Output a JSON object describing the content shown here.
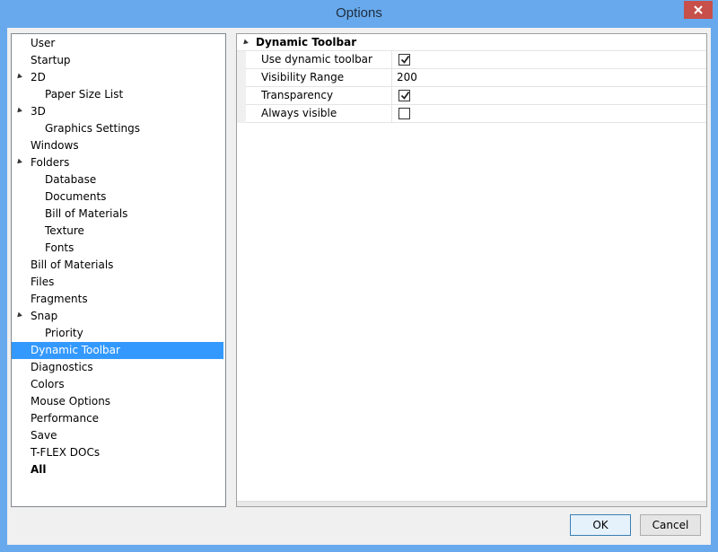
{
  "window": {
    "title": "Options"
  },
  "tree": {
    "items": [
      {
        "label": "User",
        "level": 0
      },
      {
        "label": "Startup",
        "level": 0
      },
      {
        "label": "2D",
        "level": 0,
        "expanded": true
      },
      {
        "label": "Paper Size List",
        "level": 1
      },
      {
        "label": "3D",
        "level": 0,
        "expanded": true
      },
      {
        "label": "Graphics Settings",
        "level": 1
      },
      {
        "label": "Windows",
        "level": 0
      },
      {
        "label": "Folders",
        "level": 0,
        "expanded": true
      },
      {
        "label": "Database",
        "level": 1
      },
      {
        "label": "Documents",
        "level": 1
      },
      {
        "label": "Bill of Materials",
        "level": 1
      },
      {
        "label": "Texture",
        "level": 1
      },
      {
        "label": "Fonts",
        "level": 1
      },
      {
        "label": "Bill of Materials",
        "level": 0
      },
      {
        "label": "Files",
        "level": 0
      },
      {
        "label": "Fragments",
        "level": 0
      },
      {
        "label": "Snap",
        "level": 0,
        "expanded": true
      },
      {
        "label": "Priority",
        "level": 1
      },
      {
        "label": "Dynamic Toolbar",
        "level": 0,
        "selected": true
      },
      {
        "label": "Diagnostics",
        "level": 0
      },
      {
        "label": "Colors",
        "level": 0
      },
      {
        "label": "Mouse Options",
        "level": 0
      },
      {
        "label": "Performance",
        "level": 0
      },
      {
        "label": "Save",
        "level": 0
      },
      {
        "label": "T-FLEX DOCs",
        "level": 0
      },
      {
        "label": "All",
        "level": 0,
        "bold": true
      }
    ]
  },
  "properties": {
    "category": "Dynamic Toolbar",
    "rows": [
      {
        "name": "Use dynamic toolbar",
        "type": "checkbox",
        "checked": true
      },
      {
        "name": "Visibility Range",
        "type": "text",
        "value": "200"
      },
      {
        "name": "Transparency",
        "type": "checkbox",
        "checked": true
      },
      {
        "name": "Always visible",
        "type": "checkbox",
        "checked": false
      }
    ]
  },
  "buttons": {
    "ok": "OK",
    "cancel": "Cancel"
  },
  "colors": {
    "accent": "#3399ff",
    "titlebar": "#67a9ec",
    "close": "#c7504a"
  }
}
